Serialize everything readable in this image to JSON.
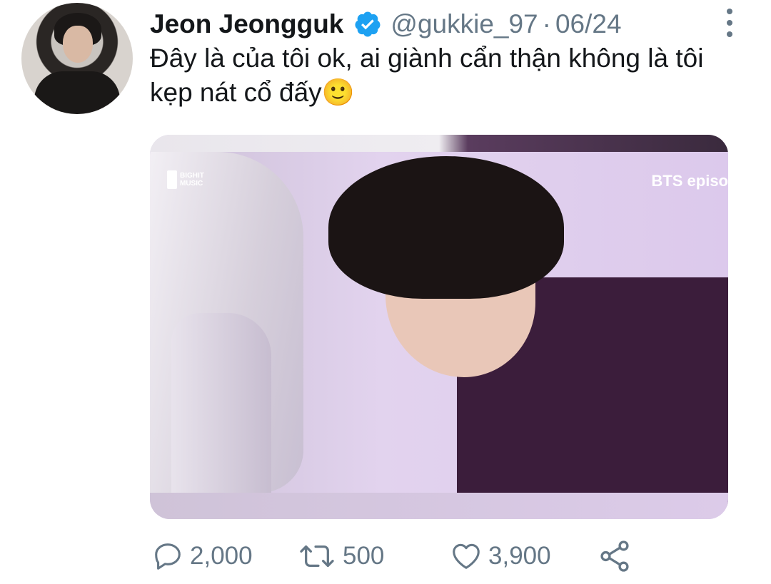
{
  "tweet": {
    "author_name": "Jeon Jeongguk",
    "handle": "@gukkie_97",
    "separator": "·",
    "date": "06/24",
    "text": "Đây là của tôi ok, ai giành cẩn thận không là tôi kẹp nát cổ đấy🙂"
  },
  "media": {
    "watermark_logo": "BIGHIT MUSIC",
    "watermark_episode": "BTS episo"
  },
  "actions": {
    "reply_count": "2,000",
    "retweet_count": "500",
    "like_count": "3,900"
  },
  "icons": {
    "verified": "verified-badge-icon",
    "more": "more-vertical-icon",
    "reply": "reply-icon",
    "retweet": "retweet-icon",
    "like": "heart-icon",
    "share": "share-icon"
  },
  "colors": {
    "verified_blue": "#1da1f2",
    "secondary_text": "#657786",
    "primary_text": "#14171a"
  }
}
